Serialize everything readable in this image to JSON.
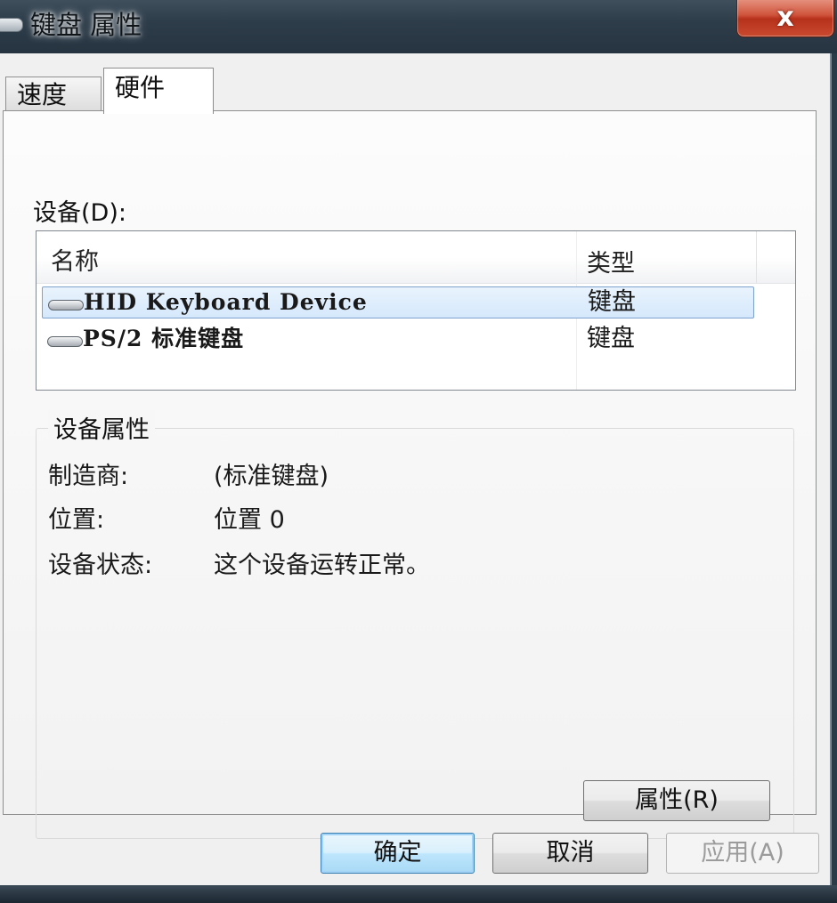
{
  "window": {
    "title": "键盘 属性",
    "close_glyph": "x"
  },
  "tabs": [
    {
      "label": "速度",
      "active": false
    },
    {
      "label": "硬件",
      "active": true
    }
  ],
  "devices": {
    "label": "设备(D):",
    "columns": {
      "name": "名称",
      "type": "类型"
    },
    "rows": [
      {
        "name": "HID Keyboard Device",
        "type": "键盘",
        "selected": true,
        "icon": "keyboard-icon"
      },
      {
        "name": "PS/2 标准键盘",
        "type": "键盘",
        "selected": false,
        "icon": "keyboard-icon"
      }
    ]
  },
  "device_properties": {
    "group_title": "设备属性",
    "manufacturer_label": "制造商:",
    "manufacturer_value": "(标准键盘)",
    "location_label": "位置:",
    "location_value": "位置 0",
    "status_label": "设备状态:",
    "status_value": "这个设备运转正常。",
    "properties_button": "属性(R)"
  },
  "footer": {
    "ok_label": "确定",
    "cancel_label": "取消",
    "apply_label": "应用(A)"
  },
  "colors": {
    "selection_fill": "#d5e8fb",
    "selection_border": "#7da2ce",
    "close_button": "#c94a2f",
    "default_button_border": "#3c7fb1"
  }
}
